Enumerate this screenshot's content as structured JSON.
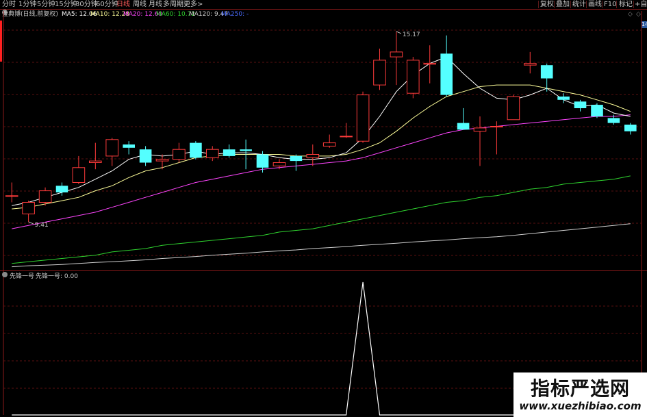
{
  "toolbar": {
    "periods": [
      "分时",
      "1分钟",
      "5分钟",
      "15分钟",
      "30分钟",
      "60分钟",
      "日线",
      "周线",
      "月线",
      "多周期",
      "更多>"
    ],
    "active_period": "日线",
    "right_buttons": [
      "复权",
      "叠加",
      "统计",
      "画线",
      "F10",
      "标记",
      "+自选"
    ]
  },
  "legend": {
    "stock": "金典博(日线,前复权)",
    "ma5": "MA5: 12.06",
    "ma10": "MA10: 12.28",
    "ma20": "MA20: 12.60",
    "ma60": "MA60: 10.72",
    "ma120": "MA120: 9.47",
    "ma250": "MA250: -"
  },
  "colors": {
    "bg": "#000000",
    "up": "#ff3b3b",
    "down": "#54ffff",
    "ma5": "#ffffff",
    "ma10": "#ffff9a",
    "ma20": "#ff45ff",
    "ma60": "#2fd42f",
    "ma120": "#d0d0d0",
    "grid": "#5a0f0f"
  },
  "price_labels": {
    "high": "15.17",
    "low": "9.41"
  },
  "indicator_legend": {
    "name": "先锋一号",
    "value_label": "先锋一号: 0.00"
  },
  "scroll_badge": "14",
  "watermark": {
    "title": "指标严选网",
    "url": "www.xuezhibiao.com"
  },
  "chart_data": {
    "type": "candlestick",
    "candles": [
      {
        "o": 10.2,
        "c": 10.2,
        "h": 10.6,
        "l": 10.0
      },
      {
        "o": 9.65,
        "c": 10.0,
        "h": 10.05,
        "l": 9.41
      },
      {
        "o": 10.0,
        "c": 10.35,
        "h": 10.45,
        "l": 9.9
      },
      {
        "o": 10.5,
        "c": 10.3,
        "h": 10.6,
        "l": 10.2
      },
      {
        "o": 10.6,
        "c": 11.05,
        "h": 11.4,
        "l": 10.55
      },
      {
        "o": 11.2,
        "c": 11.25,
        "h": 11.8,
        "l": 11.0
      },
      {
        "o": 11.4,
        "c": 11.9,
        "h": 11.95,
        "l": 11.1
      },
      {
        "o": 11.75,
        "c": 11.65,
        "h": 11.85,
        "l": 11.45
      },
      {
        "o": 11.6,
        "c": 11.2,
        "h": 11.7,
        "l": 11.1
      },
      {
        "o": 11.25,
        "c": 11.3,
        "h": 11.45,
        "l": 11.0
      },
      {
        "o": 11.3,
        "c": 11.6,
        "h": 11.8,
        "l": 11.2
      },
      {
        "o": 11.8,
        "c": 11.35,
        "h": 11.85,
        "l": 11.3
      },
      {
        "o": 11.35,
        "c": 11.6,
        "h": 11.7,
        "l": 11.25
      },
      {
        "o": 11.6,
        "c": 11.4,
        "h": 11.75,
        "l": 11.35
      },
      {
        "o": 11.6,
        "c": 11.55,
        "h": 11.9,
        "l": 11.0
      },
      {
        "o": 11.45,
        "c": 11.05,
        "h": 11.55,
        "l": 10.9
      },
      {
        "o": 11.1,
        "c": 11.2,
        "h": 11.3,
        "l": 11.0
      },
      {
        "o": 11.4,
        "c": 11.25,
        "h": 11.45,
        "l": 10.95
      },
      {
        "o": 11.35,
        "c": 11.45,
        "h": 11.75,
        "l": 11.1
      },
      {
        "o": 11.7,
        "c": 11.8,
        "h": 12.05,
        "l": 11.65
      },
      {
        "o": 12.0,
        "c": 12.0,
        "h": 12.4,
        "l": 11.95
      },
      {
        "o": 11.85,
        "c": 13.25,
        "h": 13.35,
        "l": 11.8
      },
      {
        "o": 13.55,
        "c": 14.3,
        "h": 14.65,
        "l": 13.4
      },
      {
        "o": 14.4,
        "c": 14.55,
        "h": 15.17,
        "l": 13.55
      },
      {
        "o": 13.3,
        "c": 14.3,
        "h": 14.4,
        "l": 13.15
      },
      {
        "o": 14.2,
        "c": 14.2,
        "h": 14.75,
        "l": 13.6
      },
      {
        "o": 14.5,
        "c": 13.25,
        "h": 15.05,
        "l": 13.2
      },
      {
        "o": 12.4,
        "c": 12.2,
        "h": 12.85,
        "l": 12.25
      },
      {
        "o": 12.15,
        "c": 12.25,
        "h": 12.6,
        "l": 11.1
      },
      {
        "o": 12.3,
        "c": 12.3,
        "h": 12.45,
        "l": 11.45
      },
      {
        "o": 12.5,
        "c": 13.2,
        "h": 13.25,
        "l": 12.5
      },
      {
        "o": 14.15,
        "c": 14.2,
        "h": 14.55,
        "l": 13.9
      },
      {
        "o": 14.15,
        "c": 13.75,
        "h": 14.2,
        "l": 13.35
      },
      {
        "o": 13.2,
        "c": 13.1,
        "h": 13.3,
        "l": 13.0
      },
      {
        "o": 13.05,
        "c": 12.85,
        "h": 13.1,
        "l": 12.75
      },
      {
        "o": 12.95,
        "c": 12.6,
        "h": 13.0,
        "l": 12.55
      },
      {
        "o": 12.55,
        "c": 12.4,
        "h": 12.65,
        "l": 12.35
      },
      {
        "o": 12.35,
        "c": 12.15,
        "h": 12.4,
        "l": 12.05
      }
    ],
    "ma5": [
      9.9,
      10.0,
      10.15,
      10.3,
      10.45,
      10.7,
      10.95,
      11.3,
      11.45,
      11.4,
      11.45,
      11.55,
      11.45,
      11.5,
      11.5,
      11.45,
      11.35,
      11.3,
      11.3,
      11.35,
      11.5,
      11.95,
      12.6,
      13.35,
      13.85,
      14.2,
      14.4,
      13.9,
      13.45,
      13.15,
      13.1,
      13.25,
      13.45,
      13.1,
      12.9,
      12.95,
      12.7,
      12.6
    ],
    "ma10": [
      9.8,
      9.85,
      9.95,
      10.05,
      10.15,
      10.35,
      10.5,
      10.75,
      10.95,
      11.05,
      11.2,
      11.35,
      11.4,
      11.45,
      11.45,
      11.45,
      11.45,
      11.4,
      11.4,
      11.4,
      11.45,
      11.6,
      11.8,
      12.15,
      12.55,
      12.9,
      13.2,
      13.35,
      13.5,
      13.55,
      13.55,
      13.55,
      13.45,
      13.35,
      13.25,
      13.1,
      12.95,
      12.75
    ],
    "ma20": [
      9.2,
      9.3,
      9.4,
      9.5,
      9.6,
      9.7,
      9.85,
      10.0,
      10.15,
      10.3,
      10.45,
      10.6,
      10.7,
      10.8,
      10.9,
      11.0,
      11.05,
      11.1,
      11.15,
      11.2,
      11.25,
      11.35,
      11.5,
      11.65,
      11.8,
      11.95,
      12.1,
      12.2,
      12.25,
      12.3,
      12.35,
      12.4,
      12.45,
      12.5,
      12.55,
      12.6,
      12.6,
      12.65
    ],
    "ma60": [
      8.15,
      8.2,
      8.25,
      8.3,
      8.35,
      8.4,
      8.5,
      8.55,
      8.6,
      8.7,
      8.75,
      8.8,
      8.85,
      8.9,
      8.95,
      9.0,
      9.1,
      9.15,
      9.2,
      9.3,
      9.4,
      9.5,
      9.6,
      9.7,
      9.8,
      9.9,
      10.0,
      10.05,
      10.15,
      10.2,
      10.3,
      10.4,
      10.45,
      10.55,
      10.6,
      10.65,
      10.7,
      10.8
    ],
    "ma120": [
      8.05,
      8.08,
      8.1,
      8.12,
      8.15,
      8.18,
      8.2,
      8.23,
      8.26,
      8.3,
      8.33,
      8.36,
      8.4,
      8.43,
      8.46,
      8.5,
      8.53,
      8.56,
      8.6,
      8.63,
      8.66,
      8.7,
      8.73,
      8.76,
      8.8,
      8.83,
      8.86,
      8.9,
      8.93,
      8.96,
      9.0,
      9.05,
      9.1,
      9.15,
      9.2,
      9.25,
      9.3,
      9.35
    ],
    "indicator": [
      0,
      0,
      0,
      0,
      0,
      0,
      0,
      0,
      0,
      0,
      0,
      0,
      0,
      0,
      0,
      0,
      0,
      0,
      0,
      0,
      0,
      1,
      0,
      0,
      0,
      0,
      0,
      0,
      0,
      0,
      0,
      0,
      0,
      0,
      0,
      0,
      0,
      0
    ],
    "ylim": [
      8.0,
      15.5
    ]
  }
}
